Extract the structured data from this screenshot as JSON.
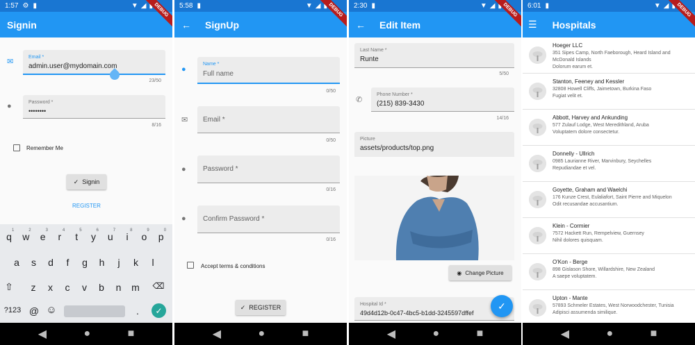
{
  "screen1": {
    "time": "1:57",
    "title": "Signin",
    "email": {
      "label": "Email *",
      "value": "admin.user@mydomain.com",
      "counter": "23/50"
    },
    "password": {
      "label": "Password *",
      "value": "••••••••",
      "counter": "8/16"
    },
    "remember_label": "Remember Me",
    "signin_label": "Signin",
    "register_label": "REGISTER",
    "keyboard": {
      "row1": [
        "q",
        "w",
        "e",
        "r",
        "t",
        "y",
        "u",
        "i",
        "o",
        "p"
      ],
      "row1_hints": [
        "1",
        "2",
        "3",
        "4",
        "5",
        "6",
        "7",
        "8",
        "9",
        "0"
      ],
      "row2": [
        "a",
        "s",
        "d",
        "f",
        "g",
        "h",
        "j",
        "k",
        "l"
      ],
      "row3": [
        "z",
        "x",
        "c",
        "v",
        "b",
        "n",
        "m"
      ],
      "sym_key": "?123",
      "at_key": "@",
      "emoji_key": "☺",
      "period_key": "."
    }
  },
  "screen2": {
    "time": "5:58",
    "title": "SignUp",
    "name": {
      "label": "Name *",
      "placeholder": "Full name",
      "counter": "0/50"
    },
    "email": {
      "label": "Email *",
      "counter": "0/50"
    },
    "password": {
      "label": "Password *",
      "counter": "0/16"
    },
    "confirm": {
      "label": "Confirm Password *",
      "counter": "0/16"
    },
    "terms_label": "Accept terms & conditions",
    "register_label": "REGISTER"
  },
  "screen3": {
    "time": "2:30",
    "title": "Edit Item",
    "last_name": {
      "label": "Last Name *",
      "value": "Runte",
      "counter": "5/50"
    },
    "phone": {
      "label": "Phone Number *",
      "value": "(215) 839-3430",
      "counter": "14/16"
    },
    "picture": {
      "label": "Picture",
      "value": "assets/products/top.png"
    },
    "change_picture_label": "Change Picture",
    "hospital_id": {
      "label": "Hospital Id *",
      "value": "49d4d12b-0c47-4bc5-b1dd-3245597dffef"
    }
  },
  "screen4": {
    "time": "6:01",
    "title": "Hospitals",
    "items": [
      {
        "name": "Hoeger LLC",
        "address": "351 Sipes Camp, North Faeborough, Heard Island and McDonald Islands",
        "tagline": "Dolorum earum et."
      },
      {
        "name": "Stanton, Feeney and Kessler",
        "address": "32808 Howell Cliffs, Jaimetown, Burkina Faso",
        "tagline": "Fugiat velit et."
      },
      {
        "name": "Abbott, Harvey and Ankunding",
        "address": "577 Zulauf Lodge, West Meredithland, Aruba",
        "tagline": "Voluptatem dolore consectetur."
      },
      {
        "name": "Donnelly - Ullrich",
        "address": "0985 Laurianne River, Marvinbury, Seychelles",
        "tagline": "Repudiandae et vel."
      },
      {
        "name": "Goyette, Graham and Waelchi",
        "address": "176 Kunze Crest, Eulaliafort, Saint Pierre and Miquelon",
        "tagline": "Odit recusandae accusantium."
      },
      {
        "name": "Klein - Cormier",
        "address": "7572 Hackett Run, Rempelview, Guernsey",
        "tagline": "Nihil dolores quisquam."
      },
      {
        "name": "O'Kon - Berge",
        "address": "898 Gislason Shore, Willardshire, New Zealand",
        "tagline": "A saepe voluptatem."
      },
      {
        "name": "Upton - Mante",
        "address": "57893 Schmeler Estates, West Norwoodchester, Tunisia",
        "tagline": "Adipisci assumenda similique."
      }
    ]
  },
  "debug_label": "DEBUG",
  "colors": {
    "primary": "#2196f3",
    "status": "#1976d2",
    "debug": "#b71c1c",
    "enter": "#26a69a"
  }
}
